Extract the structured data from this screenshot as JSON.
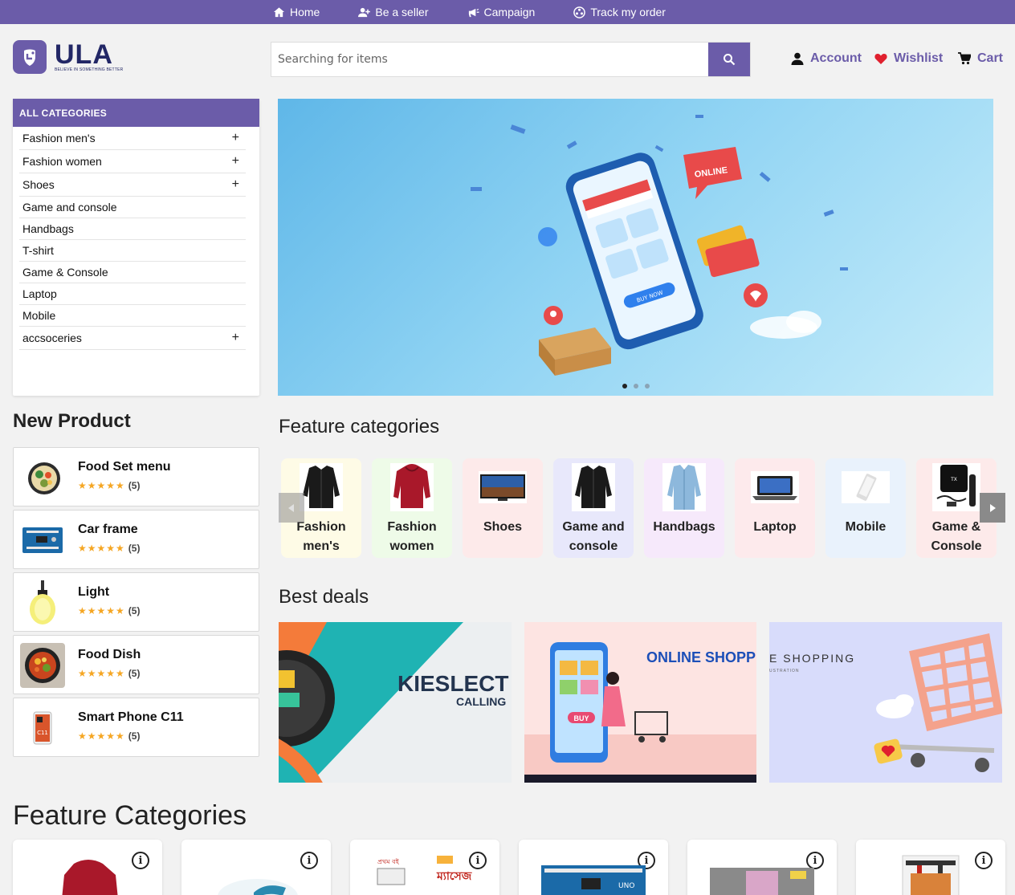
{
  "topnav": {
    "items": [
      {
        "label": "Home",
        "icon": "home-icon"
      },
      {
        "label": "Be a seller",
        "icon": "user-plus-icon"
      },
      {
        "label": "Campaign",
        "icon": "megaphone-icon"
      },
      {
        "label": "Track my order",
        "icon": "track-icon"
      }
    ]
  },
  "header": {
    "logo_text": "ULA",
    "logo_tagline": "BELIEVE IN SOMETHING BETTER",
    "search_placeholder": "Searching for items",
    "account_label": "Account",
    "wishlist_label": "Wishlist",
    "cart_label": "Cart"
  },
  "colors": {
    "brand": "#6b5ca9",
    "star": "#f5a623",
    "wishlist": "#e0202e"
  },
  "sidebar": {
    "title": "ALL CATEGORIES",
    "items": [
      {
        "label": "Fashion men's",
        "expandable": "+"
      },
      {
        "label": "Fashion women",
        "expandable": "+"
      },
      {
        "label": "Shoes",
        "expandable": "+"
      },
      {
        "label": "Game and console",
        "expandable": ""
      },
      {
        "label": "Handbags",
        "expandable": ""
      },
      {
        "label": "T-shirt",
        "expandable": ""
      },
      {
        "label": "Game & Console",
        "expandable": ""
      },
      {
        "label": "Laptop",
        "expandable": ""
      },
      {
        "label": "Mobile",
        "expandable": ""
      },
      {
        "label": "accsoceries",
        "expandable": "+"
      }
    ]
  },
  "banner": {
    "slides": 3,
    "active": 1,
    "text_bubble": "ONLINE",
    "phone_button": "BUY NOW"
  },
  "new_product": {
    "title": "New Product",
    "items": [
      {
        "name": "Food Set menu",
        "stars": "★★★★★",
        "count": "(5)"
      },
      {
        "name": "Car frame",
        "stars": "★★★★★",
        "count": "(5)"
      },
      {
        "name": "Light",
        "stars": "★★★★★",
        "count": "(5)"
      },
      {
        "name": "Food Dish",
        "stars": "★★★★★",
        "count": "(5)"
      },
      {
        "name": "Smart Phone C11",
        "stars": "★★★★★",
        "count": "(5)"
      }
    ]
  },
  "feature_categories": {
    "title": "Feature categories",
    "items": [
      {
        "label": "Fashion men's",
        "bg": "#fefbe6"
      },
      {
        "label": "Fashion women",
        "bg": "#eefbe8"
      },
      {
        "label": "Shoes",
        "bg": "#fdeaea"
      },
      {
        "label": "Game and console",
        "bg": "#e8e8fb"
      },
      {
        "label": "Handbags",
        "bg": "#f6e9fb"
      },
      {
        "label": "Laptop",
        "bg": "#fdeaec"
      },
      {
        "label": "Mobile",
        "bg": "#e9f2fc"
      },
      {
        "label": "Game & Console",
        "bg": "#fdeaea"
      }
    ]
  },
  "best_deals": {
    "title": "Best deals",
    "items": [
      {
        "title": "KIESLECT",
        "subtitle": "CALLING"
      },
      {
        "title": "ONLINE SHOPPING",
        "subtitle": "BUY"
      },
      {
        "title": "E SHOPPING",
        "subtitle": "USTRATION"
      }
    ]
  },
  "feature_categories_2": {
    "title": "Feature Categories",
    "info_glyph": "i",
    "card_texts": [
      "প্রথম বই",
      "ম্যাসেজ",
      "UNO"
    ]
  }
}
